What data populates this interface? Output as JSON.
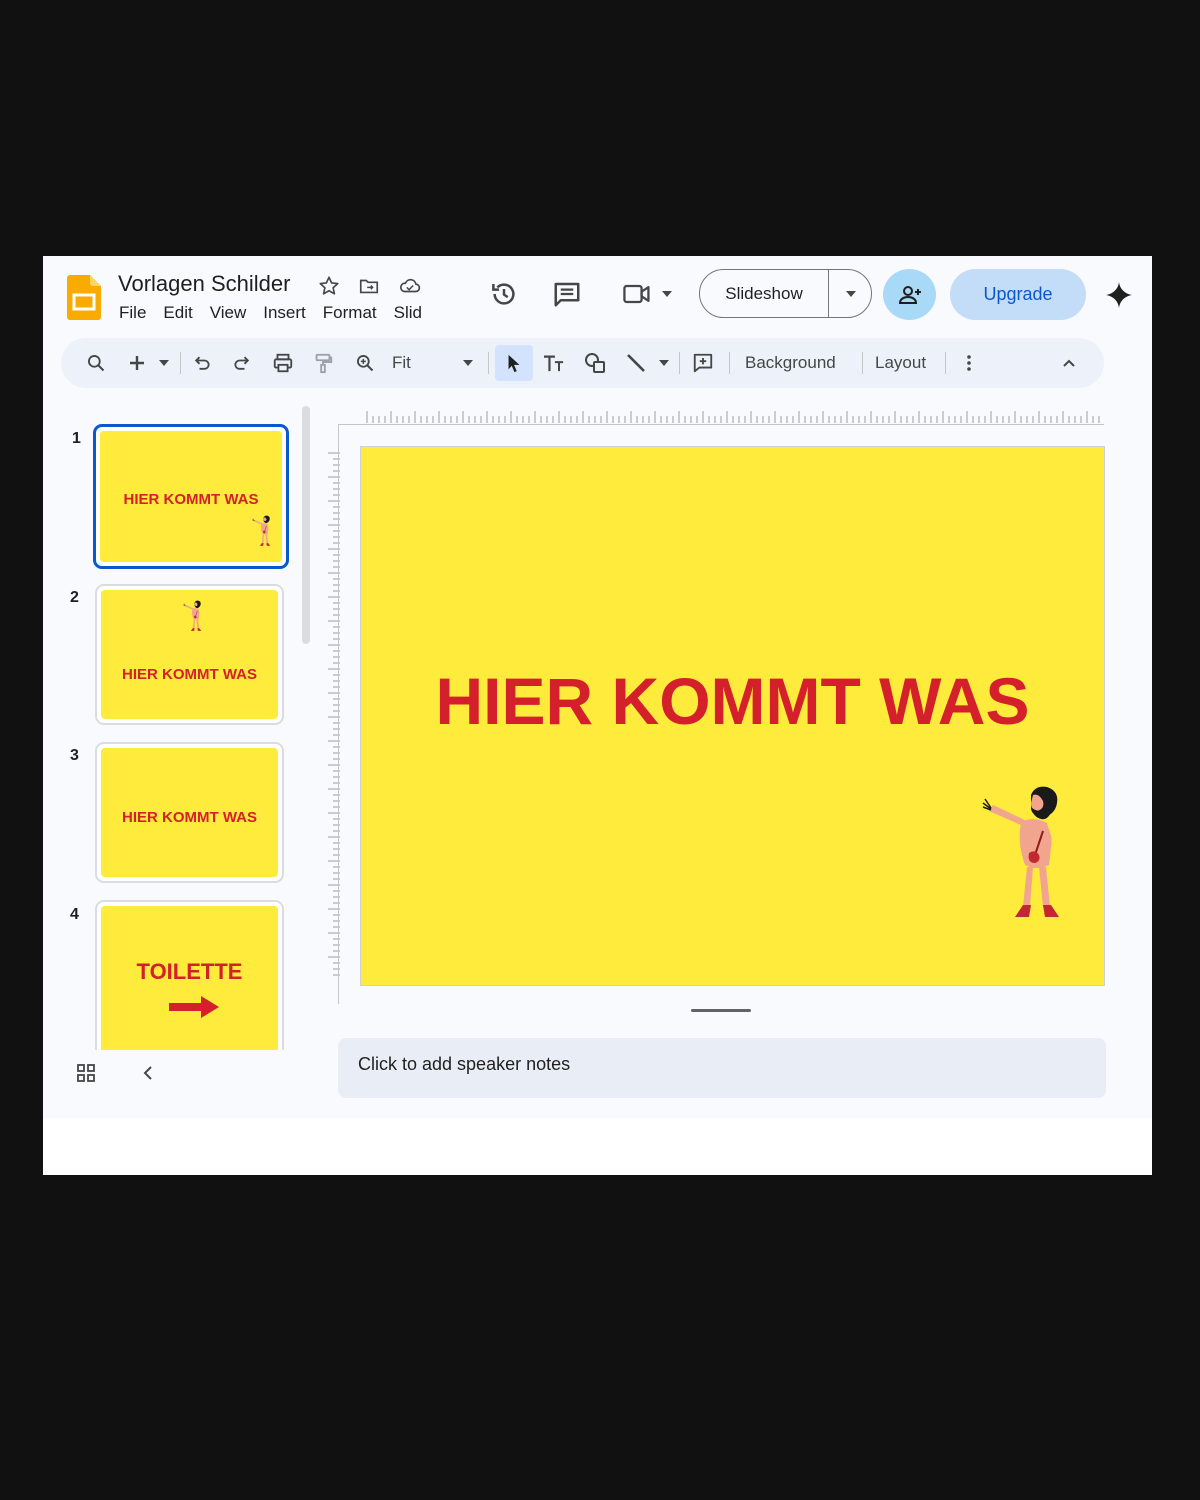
{
  "app": {
    "title": "Vorlagen Schilder",
    "menu": [
      "File",
      "Edit",
      "View",
      "Insert",
      "Format",
      "Slid"
    ],
    "accent": "#0b57d0"
  },
  "header": {
    "icons": [
      "star-icon",
      "move-to-folder-icon",
      "cloud-saved-icon",
      "version-history-icon",
      "comments-icon",
      "meet-icon"
    ],
    "slideshow_label": "Slideshow",
    "upgrade_label": "Upgrade"
  },
  "toolbar": {
    "zoom_value": "Fit",
    "background_label": "Background",
    "layout_label": "Layout"
  },
  "filmstrip": {
    "slides": [
      {
        "number": "1",
        "text": "HIER KOMMT WAS"
      },
      {
        "number": "2",
        "text": "HIER KOMMT WAS"
      },
      {
        "number": "3",
        "text": "HIER KOMMT WAS"
      },
      {
        "number": "4",
        "text": "TOILETTE"
      }
    ]
  },
  "slide": {
    "title": "HIER KOMMT WAS",
    "background_color": "#ffeb3b",
    "text_color": "#d4202a"
  },
  "notes": {
    "placeholder": "Click to add speaker notes"
  }
}
